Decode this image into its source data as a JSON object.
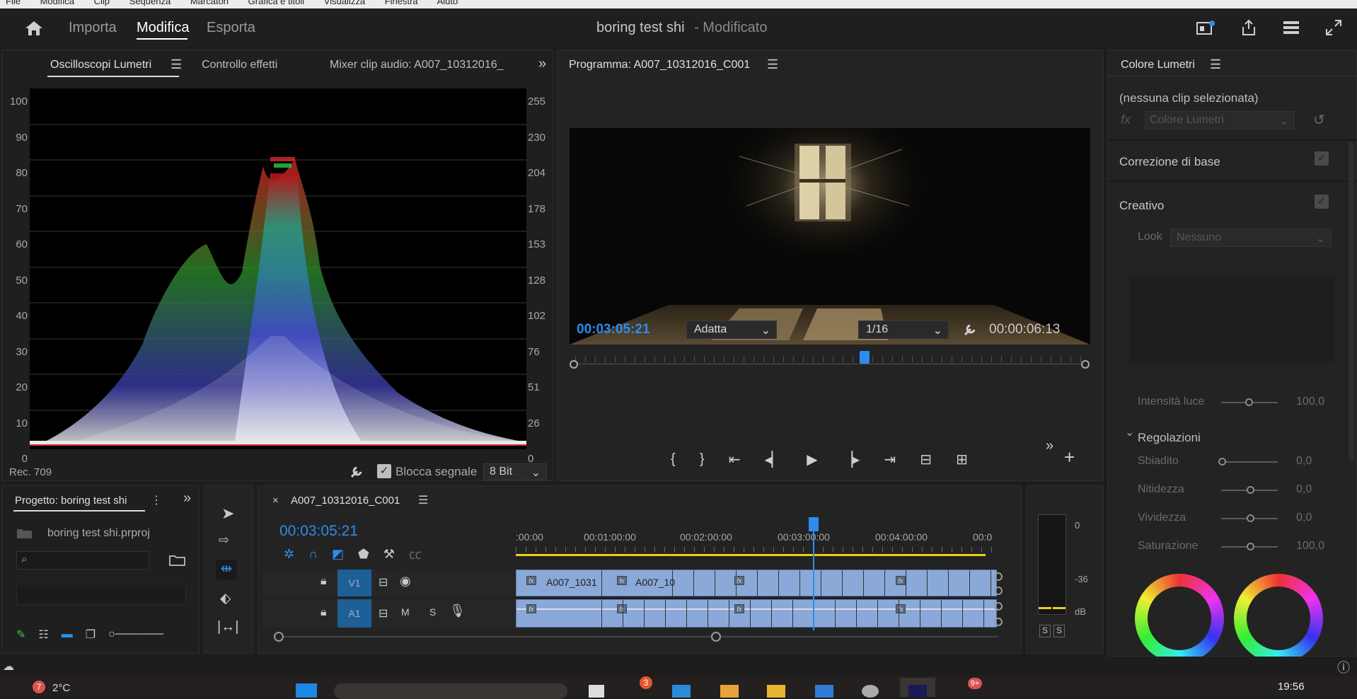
{
  "menu": [
    "File",
    "Modifica",
    "Clip",
    "Sequenza",
    "Marcatori",
    "Grafica e titoli",
    "Visualizza",
    "Finestra",
    "Aiuto"
  ],
  "workspace": {
    "tabs": [
      "Importa",
      "Modifica",
      "Esporta"
    ],
    "active": "Modifica",
    "project_title": "boring test shi",
    "modified": "- Modificato"
  },
  "scopes_panel": {
    "tabs": [
      "Oscilloscopi Lumetri",
      "Controllo effetti",
      "Mixer clip audio: A007_10312016_"
    ],
    "left_axis": [
      "100",
      "90",
      "80",
      "70",
      "60",
      "50",
      "40",
      "30",
      "20",
      "10",
      "0"
    ],
    "right_axis": [
      "255",
      "230",
      "204",
      "178",
      "153",
      "128",
      "102",
      "76",
      "51",
      "26",
      "0"
    ],
    "colorspace": "Rec. 709",
    "lock_label": "Blocca segnale",
    "bit_depth": "8 Bit"
  },
  "program_monitor": {
    "title": "Programma: A007_10312016_C001",
    "timecode": "00:03:05:21",
    "fit": "Adatta",
    "resolution": "1/16",
    "duration": "00:00:06:13"
  },
  "lumetri": {
    "title": "Colore Lumetri",
    "no_clip": "(nessuna clip selezionata)",
    "fx_select": "Colore Lumetri",
    "sections": [
      "Correzione di base",
      "Creativo"
    ],
    "look_label": "Look",
    "look_value": "Nessuno",
    "intensity_label": "Intensità luce",
    "intensity_value": "100,0",
    "adjustments_title": "Regolazioni",
    "adjustments": [
      {
        "label": "Sbiadito",
        "value": "0,0",
        "pos": 0.0
      },
      {
        "label": "Nitidezza",
        "value": "0,0",
        "pos": 0.5
      },
      {
        "label": "Vividezza",
        "value": "0,0",
        "pos": 0.5
      },
      {
        "label": "Saturazione",
        "value": "100,0",
        "pos": 0.5
      }
    ]
  },
  "project_panel": {
    "title": "Progetto: boring test shi",
    "file": "boring test shi.prproj"
  },
  "timeline": {
    "sequence": "A007_10312016_C001",
    "timecode": "00:03:05:21",
    "ruler": [
      ":00:00",
      "00:01:00:00",
      "00:02:00:00",
      "00:03:00:00",
      "00:04:00:00",
      "00:0"
    ],
    "tracks": [
      {
        "name": "V1",
        "type": "video"
      },
      {
        "name": "A1",
        "type": "audio",
        "m": "M",
        "s": "S"
      }
    ],
    "clips": [
      "A007_1031",
      "A007_10"
    ]
  },
  "audio_meter": {
    "labels": [
      "0",
      "-36",
      "dB"
    ],
    "solo": [
      "S",
      "S"
    ]
  },
  "taskbar": {
    "notif": "7",
    "weather": "2°C",
    "badge1": "3",
    "badge2": "9+",
    "time": "19:56"
  },
  "colors": {
    "accent": "#2d8ceb",
    "clip": "#8aa9d8",
    "playhead": "#2d8ceb",
    "bg": "#1d1d1d"
  }
}
